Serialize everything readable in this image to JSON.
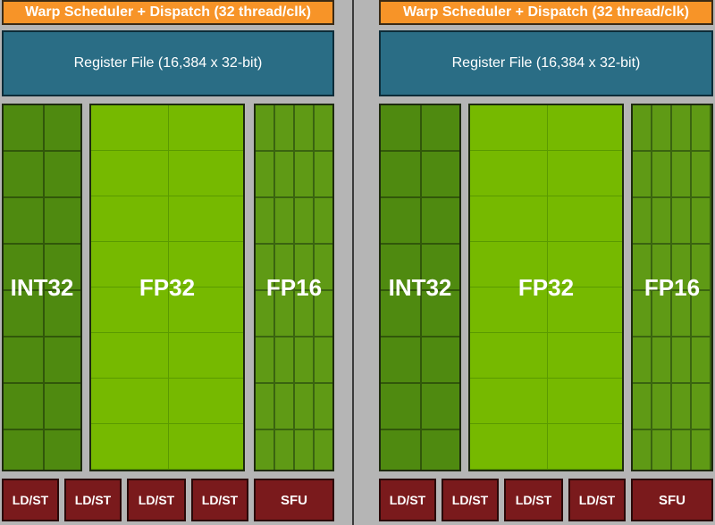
{
  "sm_partitions": [
    {
      "warp_scheduler": "Warp Scheduler + Dispatch (32 thread/clk)",
      "register_file": "Register File (16,384 x 32-bit)",
      "int32_label": "INT32",
      "fp32_label": "FP32",
      "fp16_label": "FP16",
      "ldst_units": [
        "LD/ST",
        "LD/ST",
        "LD/ST",
        "LD/ST"
      ],
      "sfu_label": "SFU"
    },
    {
      "warp_scheduler": "Warp Scheduler + Dispatch (32 thread/clk)",
      "register_file": "Register File (16,384 x 32-bit)",
      "int32_label": "INT32",
      "fp32_label": "FP32",
      "fp16_label": "FP16",
      "ldst_units": [
        "LD/ST",
        "LD/ST",
        "LD/ST",
        "LD/ST"
      ],
      "sfu_label": "SFU"
    }
  ],
  "colors": {
    "warp_scheduler": "#f79428",
    "register_file": "#2a6d85",
    "int32": "#4f8a10",
    "fp32": "#76b900",
    "fp16": "#5f9a15",
    "ldst": "#7a1a1c",
    "sfu": "#7a1a1c",
    "background": "#b5b5b5"
  }
}
